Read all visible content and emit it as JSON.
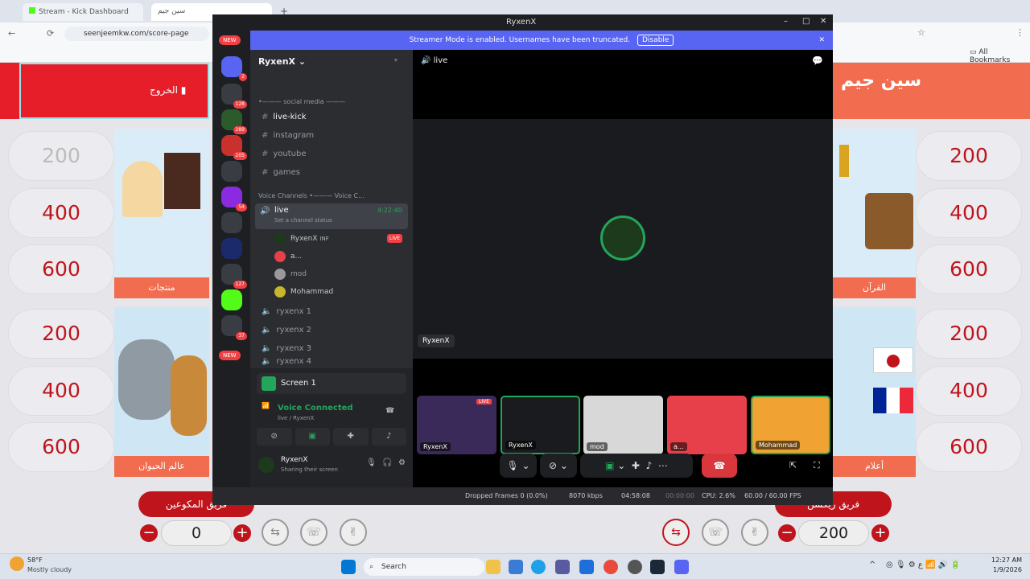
{
  "browser": {
    "tabs": [
      {
        "label": "Stream - Kick Dashboard"
      },
      {
        "label": "سين جيم"
      }
    ],
    "url": "seenjeemkw.com/score-page",
    "bookmarks_label": "All Bookmarks"
  },
  "game": {
    "exit_label": "الخروج",
    "logo_text": "سين جيم",
    "left_scores_col1": [
      "200",
      "400",
      "600",
      "200",
      "400",
      "600"
    ],
    "right_scores_col": [
      "200",
      "400",
      "600",
      "200",
      "400",
      "600"
    ],
    "categories": {
      "top_left": "منتجات",
      "top_right": "القرآن",
      "bottom_left": "عالم الحيوان",
      "bottom_right": "أعلام"
    },
    "team_left": {
      "name": "فريق المكوعين",
      "score": "0"
    },
    "team_right": {
      "name": "فريق ريكسن",
      "score": "200"
    },
    "minus": "−",
    "plus": "+"
  },
  "discord": {
    "window_title": "RyxenX",
    "streamer_bar": {
      "text": "Streamer Mode is enabled. Usernames have been truncated.",
      "disable_label": "Disable"
    },
    "server_badges": [
      "2",
      "128",
      "289",
      "205",
      "54",
      "127",
      "37"
    ],
    "new_label": "NEW",
    "server_name": "RyxenX",
    "category_social": "social media",
    "channels": [
      {
        "name": "live-kick"
      },
      {
        "name": "instagram"
      },
      {
        "name": "youtube"
      },
      {
        "name": "games"
      }
    ],
    "voice_category": "Voice Channels",
    "voice_category_tail": "Voice C...",
    "live_channel": {
      "name": "live",
      "time": "4:22:40",
      "status": "Set a channel status"
    },
    "voice_users": [
      {
        "name": "RyxenX",
        "extra": "INF",
        "live": "LIVE"
      },
      {
        "name": "a..."
      },
      {
        "name": "mod"
      },
      {
        "name": "Mohammad"
      }
    ],
    "other_voice": [
      "ryxenx 1",
      "ryxenx 2",
      "ryxenx 3",
      "ryxenx 4"
    ],
    "screen_share": {
      "title": "Screen 1"
    },
    "voice_connected": {
      "title": "Voice Connected",
      "sub": "live / RyxenX"
    },
    "me": {
      "name": "RyxenX",
      "status": "Sharing their screen"
    },
    "stage": {
      "channel": "live",
      "speaker": "RyxenX"
    },
    "tiles": [
      {
        "label": "RyxenX",
        "live": "LIVE"
      },
      {
        "label": "RyxenX"
      },
      {
        "label": "mod"
      },
      {
        "label": "a..."
      },
      {
        "label": "Mohammad"
      }
    ]
  },
  "obs": {
    "dropped": "Dropped Frames 0 (0.0%)",
    "bitrate": "8070 kbps",
    "rec_time": "04:58:08",
    "stream_time": "00:00:00",
    "cpu": "CPU: 2.6%",
    "fps": "60.00 / 60.00 FPS"
  },
  "taskbar": {
    "weather_temp": "58°F",
    "weather_desc": "Mostly cloudy",
    "search": "Search",
    "time": "12:27 AM",
    "date": "1/9/2026"
  }
}
